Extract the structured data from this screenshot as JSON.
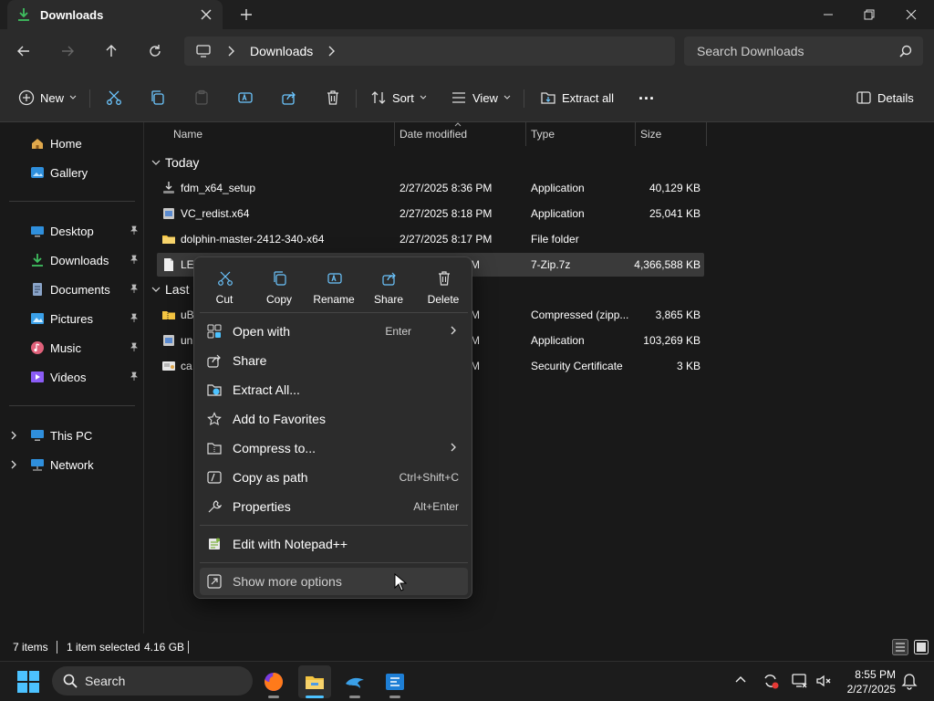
{
  "window": {
    "tab_title": "Downloads",
    "new_tab": "+"
  },
  "nav": {
    "address_crumb": "Downloads",
    "search_placeholder": "Search Downloads"
  },
  "commands": {
    "new": "New",
    "sort": "Sort",
    "view": "View",
    "extract_all": "Extract all",
    "more": "...",
    "details": "Details"
  },
  "sidebar": {
    "items": [
      {
        "label": "Home"
      },
      {
        "label": "Gallery"
      },
      {
        "label": "Desktop"
      },
      {
        "label": "Downloads"
      },
      {
        "label": "Documents"
      },
      {
        "label": "Pictures"
      },
      {
        "label": "Music"
      },
      {
        "label": "Videos"
      },
      {
        "label": "This PC"
      },
      {
        "label": "Network"
      }
    ]
  },
  "columns": {
    "name": "Name",
    "date": "Date modified",
    "type": "Type",
    "size": "Size"
  },
  "groups": {
    "today": "Today",
    "last": "Last"
  },
  "files": [
    {
      "name": "fdm_x64_setup",
      "date": "2/27/2025 8:36 PM",
      "type": "Application",
      "size": "40,129 KB"
    },
    {
      "name": "VC_redist.x64",
      "date": "2/27/2025 8:18 PM",
      "type": "Application",
      "size": "25,041 KB"
    },
    {
      "name": "dolphin-master-2412-340-x64",
      "date": "2/27/2025 8:17 PM",
      "type": "File folder",
      "size": ""
    },
    {
      "name": "LE",
      "date": "PM",
      "type": "7-Zip.7z",
      "size": "4,366,588 KB"
    },
    {
      "name": "uB",
      "date": "AM",
      "type": "Compressed (zipp...",
      "size": "3,865 KB"
    },
    {
      "name": "un",
      "date": "AM",
      "type": "Application",
      "size": "103,269 KB"
    },
    {
      "name": "ca",
      "date": "AM",
      "type": "Security Certificate",
      "size": "3 KB"
    }
  ],
  "context_menu": {
    "quick_actions": [
      {
        "label": "Cut"
      },
      {
        "label": "Copy"
      },
      {
        "label": "Rename"
      },
      {
        "label": "Share"
      },
      {
        "label": "Delete"
      }
    ],
    "items": [
      {
        "label": "Open with",
        "shortcut": "Enter"
      },
      {
        "label": "Share",
        "shortcut": ""
      },
      {
        "label": "Extract All...",
        "shortcut": ""
      },
      {
        "label": "Add to Favorites",
        "shortcut": ""
      },
      {
        "label": "Compress to...",
        "shortcut": ""
      },
      {
        "label": "Copy as path",
        "shortcut": "Ctrl+Shift+C"
      },
      {
        "label": "Properties",
        "shortcut": "Alt+Enter"
      },
      {
        "label": "Edit with Notepad++",
        "shortcut": ""
      },
      {
        "label": "Show more options",
        "shortcut": ""
      }
    ]
  },
  "status": {
    "items_count": "7 items",
    "selected": "1 item selected",
    "selected_size": "4.16 GB"
  },
  "taskbar": {
    "search_placeholder": "Search",
    "time": "8:55 PM",
    "date": "2/27/2025"
  },
  "colors": {
    "accent": "#4cc2ff",
    "folder": "#f4c542",
    "download_green": "#3fbf5f"
  }
}
